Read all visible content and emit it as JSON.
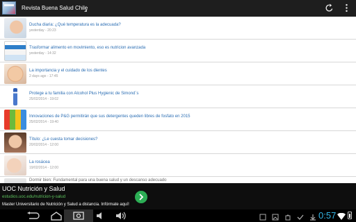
{
  "app": {
    "title": "Revista Buena Salud Chile",
    "refresh_icon": "refresh-icon",
    "overflow_icon": "overflow-menu-icon"
  },
  "articles": [
    {
      "title": "Ducha diaria: ¿Qué temperatura es la adecuada?",
      "date": "yesterday - 20:23",
      "thumb": "child-shower"
    },
    {
      "title": "Trasformar alimento en movimiento, eso es nutricion avanzada",
      "date": "yesterday - 14:32",
      "thumb": "supplement-box"
    },
    {
      "title": "La importancia y el cuidado de los dientes",
      "date": "2 days ago - 17:45",
      "thumb": "smiling-baby"
    },
    {
      "title": "Protege a tu familia con Alcohol Plus Hygienic de Simond´s",
      "date": "25/02/2014 - 19:02",
      "thumb": "alcohol-bottle"
    },
    {
      "title": "Innovaciones de P&G permitirán que sus detergentes queden libres de fosfato en 2015",
      "date": "25/02/2014 - 19:40",
      "thumb": "detergent-products"
    },
    {
      "title": "Título: ¿Le cuesta tomar decisiones?",
      "date": "20/02/2014 - 12:00",
      "thumb": "thinking-woman"
    },
    {
      "title": "La rosácea",
      "date": "19/02/2014 - 12:00",
      "thumb": "woman-face"
    },
    {
      "title": "Dormir bien: Fundamental para una buena salud y un descanso adecuado",
      "date": "",
      "thumb": "partial"
    }
  ],
  "ad": {
    "title": "UOC Nutrición y Salud",
    "url": "estudios.uoc.edu/nutricion-y-salud",
    "description": "Master Universitario de Nutrición y Salud a distancia. Infórmate aquí!",
    "accent": "#2cae55"
  },
  "system": {
    "time": "0:57",
    "time_color": "#33b5e5"
  }
}
